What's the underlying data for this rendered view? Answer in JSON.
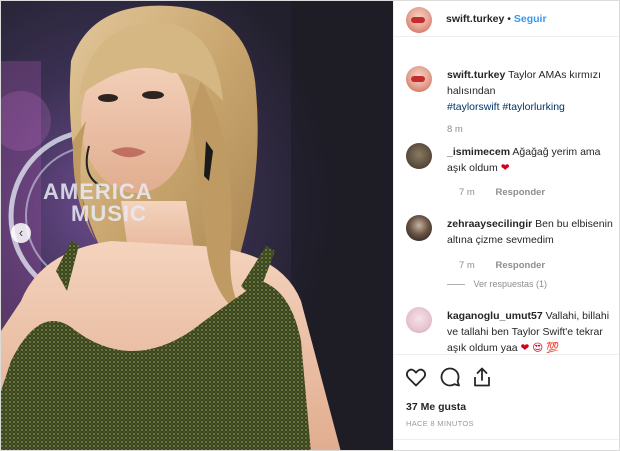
{
  "header": {
    "username": "swift.turkey",
    "separator": "•",
    "follow_label": "Seguir"
  },
  "caption": {
    "username": "swift.turkey",
    "text": "Taylor AMAs kırmızı halısından",
    "hashtags": "#taylorswift #taylorlurking",
    "time": "8 m"
  },
  "comments": [
    {
      "username": "_ismimecem",
      "text": "Ağağağ yerim ama aşık oldum",
      "emoji": "❤",
      "time": "7 m",
      "reply_label": "Responder"
    },
    {
      "username": "zehraaysecilingir",
      "text": "Ben bu elbisenin altına çizme sevmedim",
      "time": "7 m",
      "reply_label": "Responder",
      "view_replies": "Ver respuestas (1)"
    },
    {
      "username": "kaganoglu_umut57",
      "text": "Vallahi, billahi ve tallahi ben Taylor Swift'e tekrar aşık oldum yaa",
      "emoji": "❤ 😍 💯"
    }
  ],
  "actions": {
    "likes": "37 Me gusta",
    "posted": "HACE 8 MINUTOS"
  },
  "photo_text": {
    "logo_line1": "AMERICA",
    "logo_line2": "MUSIC"
  },
  "colors": {
    "follow": "#3897f0",
    "hashtag": "#003569",
    "heart": "#d1001c"
  },
  "icons": [
    "heart-icon",
    "comment-icon",
    "share-icon",
    "chevron-left-icon"
  ]
}
